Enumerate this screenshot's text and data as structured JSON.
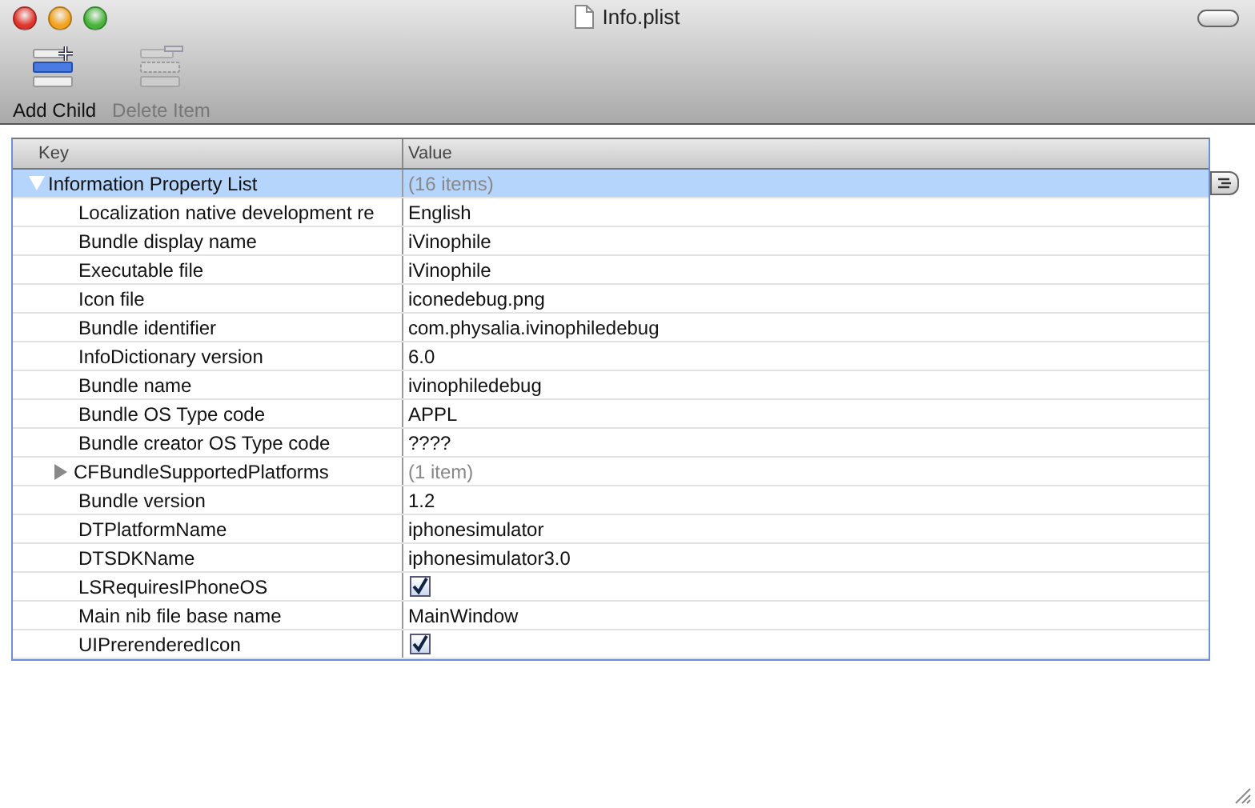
{
  "window": {
    "title": "Info.plist"
  },
  "toolbar": [
    {
      "kind": "add",
      "label": "Add Child",
      "disabled": false
    },
    {
      "kind": "delete",
      "label": "Delete Item",
      "disabled": true
    }
  ],
  "table": {
    "columns": [
      "Key",
      "Value"
    ],
    "rows": [
      {
        "key": "Information Property List",
        "kind": "count",
        "value": "(16 items)",
        "selected": true,
        "expanded": true,
        "children": [
          {
            "key": "Localization native development re",
            "kind": "text",
            "value": "English",
            "selected": false
          },
          {
            "key": "Bundle display name",
            "kind": "text",
            "value": "iVinophile",
            "selected": false
          },
          {
            "key": "Executable file",
            "kind": "text",
            "value": "iVinophile",
            "selected": false
          },
          {
            "key": "Icon file",
            "kind": "text",
            "value": "iconedebug.png",
            "selected": false
          },
          {
            "key": "Bundle identifier",
            "kind": "text",
            "value": "com.physalia.ivinophiledebug",
            "selected": false
          },
          {
            "key": "InfoDictionary version",
            "kind": "text",
            "value": "6.0",
            "selected": false
          },
          {
            "key": "Bundle name",
            "kind": "text",
            "value": "ivinophiledebug",
            "selected": false
          },
          {
            "key": "Bundle OS Type code",
            "kind": "text",
            "value": "APPL",
            "selected": false
          },
          {
            "key": "Bundle creator OS Type code",
            "kind": "text",
            "value": "????",
            "selected": false
          },
          {
            "key": "CFBundleSupportedPlatforms",
            "kind": "count",
            "value": "(1 item)",
            "selected": false,
            "expanded": false
          },
          {
            "key": "Bundle version",
            "kind": "text",
            "value": "1.2",
            "selected": false
          },
          {
            "key": "DTPlatformName",
            "kind": "text",
            "value": "iphonesimulator",
            "selected": false
          },
          {
            "key": "DTSDKName",
            "kind": "text",
            "value": "iphonesimulator3.0",
            "selected": false
          },
          {
            "key": "LSRequiresIPhoneOS",
            "kind": "bool",
            "checked": true,
            "selected": false
          },
          {
            "key": "Main nib file base name",
            "kind": "text",
            "value": "MainWindow",
            "selected": false
          },
          {
            "key": "UIPrerenderedIcon",
            "kind": "bool",
            "checked": true,
            "selected": false
          }
        ]
      }
    ]
  }
}
